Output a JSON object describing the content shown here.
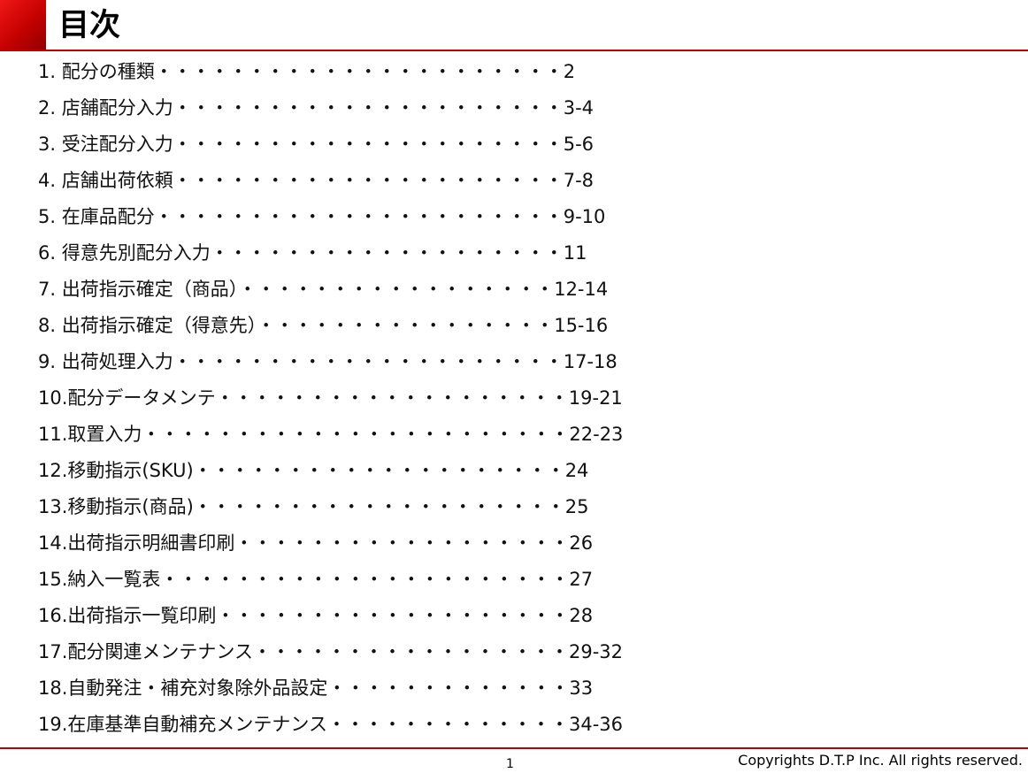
{
  "title": "目次",
  "toc": [
    "1. 配分の種類・・・・・・・・・・・・・・・・・・・・・・2",
    "2. 店舗配分入力・・・・・・・・・・・・・・・・・・・・・3-4",
    "3. 受注配分入力・・・・・・・・・・・・・・・・・・・・・5-6",
    "4. 店舗出荷依頼・・・・・・・・・・・・・・・・・・・・・7-8",
    "5. 在庫品配分・・・・・・・・・・・・・・・・・・・・・・9-10",
    "6. 得意先別配分入力・・・・・・・・・・・・・・・・・・・11",
    "7. 出荷指示確定（商品）・・・・・・・・・・・・・・・・・12-14",
    "8. 出荷指示確定（得意先）・・・・・・・・・・・・・・・・15-16",
    "9. 出荷処理入力・・・・・・・・・・・・・・・・・・・・・17-18",
    "10.配分データメンテ・・・・・・・・・・・・・・・・・・・19-21",
    "11.取置入力・・・・・・・・・・・・・・・・・・・・・・・22-23",
    "12.移動指示(SKU)・・・・・・・・・・・・・・・・・・・・24",
    "13.移動指示(商品)・・・・・・・・・・・・・・・・・・・・25",
    "14.出荷指示明細書印刷・・・・・・・・・・・・・・・・・・26",
    "15.納入一覧表・・・・・・・・・・・・・・・・・・・・・・27",
    "16.出荷指示一覧印刷・・・・・・・・・・・・・・・・・・・28",
    "17.配分関連メンテナンス・・・・・・・・・・・・・・・・・29-32",
    "18.自動発注・補充対象除外品設定・・・・・・・・・・・・・33",
    "19.在庫基準自動補充メンテナンス・・・・・・・・・・・・・34-36"
  ],
  "footer": {
    "page_number": "1",
    "copyright": "Copyrights  D.T.P Inc. All rights reserved."
  },
  "colors": {
    "accent": "#c00000",
    "text": "#111111"
  }
}
